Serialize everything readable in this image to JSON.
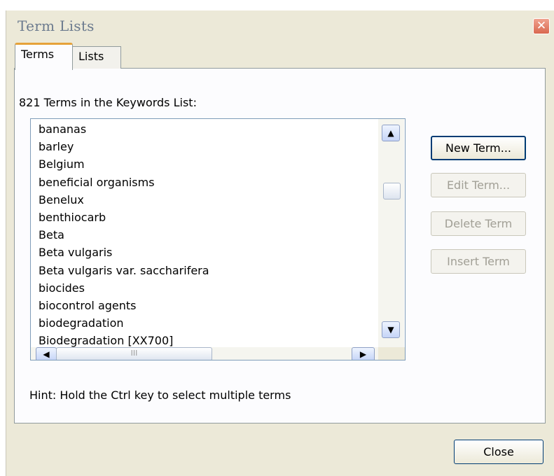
{
  "window": {
    "title": "Term Lists",
    "close_glyph": "✕"
  },
  "tabs": [
    {
      "label": "Terms",
      "active": true
    },
    {
      "label": "Lists",
      "active": false
    }
  ],
  "terms_panel": {
    "count_label": "821 Terms in the Keywords List:",
    "terms": [
      "bananas",
      "barley",
      "Belgium",
      "beneficial organisms",
      "Benelux",
      "benthiocarb",
      "Beta",
      "Beta vulgaris",
      "Beta vulgaris var. saccharifera",
      "biocides",
      "biocontrol agents",
      "biodegradation",
      "Biodegradation [XX700]"
    ],
    "hint": "Hint: Hold the Ctrl key to select multiple terms"
  },
  "buttons": {
    "new_term": "New Term...",
    "edit_term": "Edit Term...",
    "delete_term": "Delete Term",
    "insert_term": "Insert Term",
    "close": "Close"
  },
  "scrollbar": {
    "up_glyph": "▲",
    "down_glyph": "▼",
    "left_glyph": "◀",
    "right_glyph": "▶",
    "grip_glyph": "III"
  },
  "icons": {
    "close": "close-icon",
    "scroll_up": "chevron-up-icon",
    "scroll_down": "chevron-down-icon",
    "scroll_left": "chevron-left-icon",
    "scroll_right": "chevron-right-icon"
  },
  "colors": {
    "dialog_bg": "#ece9d8",
    "title_text": "#6b7a8e",
    "close_button": "#d9684f",
    "active_tab_accent": "#e6a23a",
    "disabled_text": "#a19f95"
  }
}
